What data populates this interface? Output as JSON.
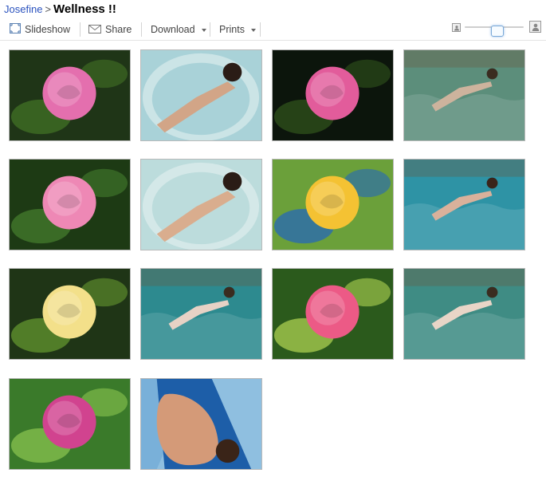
{
  "breadcrumb": {
    "parent": "Josefine",
    "separator": ">",
    "title": "Wellness !!"
  },
  "toolbar": {
    "slideshow_label": "Slideshow",
    "share_label": "Share",
    "download_label": "Download",
    "prints_label": "Prints"
  },
  "zoom": {
    "level": 0.55
  },
  "photos": [
    {
      "subject": "pink rose",
      "kind": "flower",
      "palette": {
        "bg": "#1f3517",
        "main": "#e46fae",
        "accent": "#3d6a23"
      }
    },
    {
      "subject": "swimmer in whirlpool",
      "kind": "tub",
      "palette": {
        "bg": "#a9d2d8",
        "main": "#d2a587",
        "accent": "#2a1c16"
      }
    },
    {
      "subject": "pink rose bud",
      "kind": "flower",
      "palette": {
        "bg": "#0c150c",
        "main": "#e25c9b",
        "accent": "#2b4a1a"
      }
    },
    {
      "subject": "swimmer in pool",
      "kind": "pool",
      "palette": {
        "bg": "#5c8e7b",
        "main": "#cdb39d",
        "accent": "#3a2c20"
      }
    },
    {
      "subject": "pink rose",
      "kind": "flower",
      "palette": {
        "bg": "#1d3a14",
        "main": "#ee88b5",
        "accent": "#3f7429"
      }
    },
    {
      "subject": "swimmer in whirlpool",
      "kind": "tub",
      "palette": {
        "bg": "#bcdcdc",
        "main": "#d9ad8e",
        "accent": "#2a1c16"
      }
    },
    {
      "subject": "yellow rose",
      "kind": "flower",
      "palette": {
        "bg": "#6ba03a",
        "main": "#f4c233",
        "accent": "#2e6fa8"
      }
    },
    {
      "subject": "swimmer in pool",
      "kind": "pool",
      "palette": {
        "bg": "#2e93a5",
        "main": "#d9b19b",
        "accent": "#3a241a"
      }
    },
    {
      "subject": "yellow rose",
      "kind": "flower",
      "palette": {
        "bg": "#1f3516",
        "main": "#f3e08a",
        "accent": "#5b8a2c"
      }
    },
    {
      "subject": "swimmer in indoor pool",
      "kind": "pool",
      "palette": {
        "bg": "#2d8a8f",
        "main": "#e7d2c5",
        "accent": "#3a2c20"
      }
    },
    {
      "subject": "pink roses",
      "kind": "flower",
      "palette": {
        "bg": "#2b5a1c",
        "main": "#ec5a86",
        "accent": "#9cc24a"
      }
    },
    {
      "subject": "swimmer in indoor pool",
      "kind": "pool",
      "palette": {
        "bg": "#3f8c84",
        "main": "#e8d5c7",
        "accent": "#3a2c20"
      }
    },
    {
      "subject": "peonies",
      "kind": "flower",
      "palette": {
        "bg": "#3a7a2a",
        "main": "#d1438f",
        "accent": "#7fba4a"
      }
    },
    {
      "subject": "swimmer on float",
      "kind": "float",
      "palette": {
        "bg": "#8fbfe0",
        "main": "#d49a78",
        "accent": "#1d5ea8"
      }
    }
  ]
}
